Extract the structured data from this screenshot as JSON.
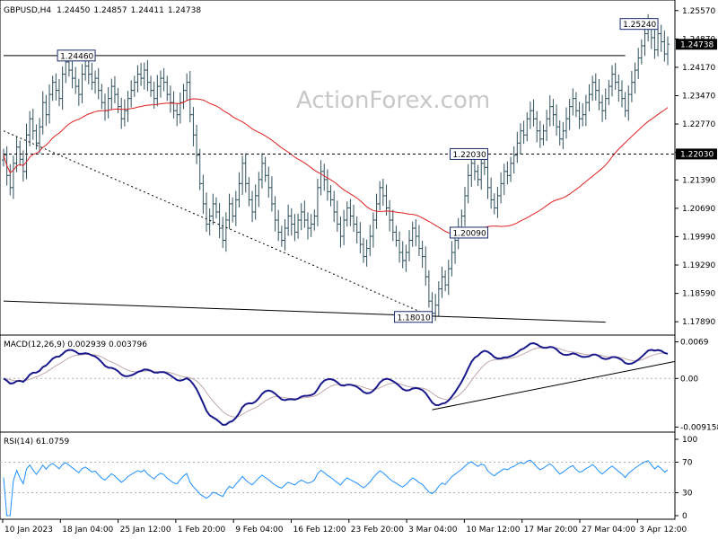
{
  "watermark": "ActionForex.com",
  "chart_data": [
    {
      "type": "candlestick",
      "title": "GBPUSD,H4",
      "ohlc_header": [
        "1.24450",
        "1.24857",
        "1.24411",
        "1.24738"
      ],
      "ylim": [
        1.1765,
        1.2572
      ],
      "y_ticks": [
        "1.25570",
        "1.24870",
        "1.24170",
        "1.23470",
        "1.22770",
        "1.22070",
        "1.21390",
        "1.20690",
        "1.19990",
        "1.19290",
        "1.18590",
        "1.17890"
      ],
      "last_price_label": "1.24738",
      "level_label": "1.22030",
      "x_tick_labels": [
        "10 Jan 2023",
        "18 Jan 04:00",
        "25 Jan 12:00",
        "1 Feb 20:00",
        "9 Feb 04:00",
        "16 Feb 12:00",
        "23 Feb 20:00",
        "3 Mar 04:00",
        "10 Mar 12:00",
        "17 Mar 20:00",
        "27 Mar 04:00",
        "3 Apr 12:00"
      ],
      "annotations": [
        {
          "text": "1.24460",
          "bar": 28,
          "value": 1.2446
        },
        {
          "text": "1.22030",
          "bar": 148,
          "value": 1.2203
        },
        {
          "text": "1.20090",
          "bar": 148,
          "value": 1.2009
        },
        {
          "text": "1.18010",
          "bar": 131,
          "value": 1.1801
        },
        {
          "text": "1.25240",
          "bar": 200,
          "value": 1.2524
        }
      ],
      "close": [
        1.22,
        1.215,
        1.212,
        1.218,
        1.222,
        1.219,
        1.216,
        1.225,
        1.229,
        1.226,
        1.223,
        1.227,
        1.233,
        1.23,
        1.235,
        1.238,
        1.236,
        1.234,
        1.24,
        1.243,
        1.241,
        1.239,
        1.237,
        1.235,
        1.24,
        1.242,
        1.24,
        1.238,
        1.239,
        1.236,
        1.233,
        1.231,
        1.234,
        1.237,
        1.235,
        1.232,
        1.229,
        1.231,
        1.234,
        1.236,
        1.238,
        1.24,
        1.239,
        1.241,
        1.238,
        1.236,
        1.234,
        1.237,
        1.239,
        1.238,
        1.235,
        1.233,
        1.231,
        1.23,
        1.233,
        1.236,
        1.238,
        1.23,
        1.225,
        1.22,
        1.213,
        1.208,
        1.203,
        1.205,
        1.208,
        1.206,
        1.202,
        1.199,
        1.204,
        1.208,
        1.205,
        1.209,
        1.213,
        1.218,
        1.213,
        1.209,
        1.206,
        1.21,
        1.214,
        1.218,
        1.215,
        1.212,
        1.208,
        1.204,
        1.201,
        1.199,
        1.202,
        1.205,
        1.203,
        1.201,
        1.204,
        1.206,
        1.204,
        1.202,
        1.203,
        1.205,
        1.212,
        1.216,
        1.214,
        1.211,
        1.209,
        1.206,
        1.203,
        1.2,
        1.204,
        1.207,
        1.205,
        1.203,
        1.201,
        1.198,
        1.195,
        1.197,
        1.2,
        1.204,
        1.208,
        1.212,
        1.21,
        1.207,
        1.204,
        1.201,
        1.199,
        1.196,
        1.194,
        1.196,
        1.199,
        1.202,
        1.2,
        1.197,
        1.195,
        1.19,
        1.184,
        1.181,
        1.183,
        1.187,
        1.19,
        1.188,
        1.192,
        1.196,
        1.199,
        1.202,
        1.205,
        1.21,
        1.215,
        1.218,
        1.216,
        1.214,
        1.218,
        1.217,
        1.212,
        1.209,
        1.207,
        1.21,
        1.213,
        1.216,
        1.215,
        1.218,
        1.22,
        1.223,
        1.226,
        1.225,
        1.229,
        1.231,
        1.229,
        1.226,
        1.224,
        1.226,
        1.229,
        1.232,
        1.23,
        1.227,
        1.224,
        1.226,
        1.229,
        1.232,
        1.234,
        1.231,
        1.229,
        1.23,
        1.233,
        1.235,
        1.238,
        1.236,
        1.233,
        1.231,
        1.234,
        1.237,
        1.24,
        1.238,
        1.236,
        1.234,
        1.231,
        1.235,
        1.238,
        1.241,
        1.244,
        1.247,
        1.25,
        1.252,
        1.249,
        1.246,
        1.25,
        1.248,
        1.245,
        1.2474
      ],
      "ma_series_name": "",
      "overlay_lines": [
        {
          "kind": "horizontal-resistance",
          "from_bar": 0,
          "to_bar": 190,
          "value": 1.2446
        },
        {
          "kind": "horizontal-dashed",
          "from_bar": 0,
          "to_bar": 215,
          "value": 1.2203
        },
        {
          "kind": "dotted-trendline",
          "from_bar": 0,
          "from_value": 1.226,
          "to_bar": 131,
          "to_value": 1.1801
        },
        {
          "kind": "long-trendline",
          "from_bar": 0,
          "from_value": 1.184,
          "to_bar": 184,
          "to_value": 1.1788
        }
      ]
    },
    {
      "type": "line",
      "title": "MACD(12,26,9) 0.002939 0.003796",
      "y_ticks": [
        "0.0069",
        "0.00",
        "-0.009158"
      ],
      "ylim": [
        -0.0096,
        0.0075
      ],
      "trendline": {
        "from_bar": 131,
        "from_value": -0.0059,
        "to_bar": 215,
        "to_value": 0.0032
      }
    },
    {
      "type": "line",
      "title": "RSI(14) 61.0759",
      "y_ticks": [
        "100",
        "70",
        "30",
        "0"
      ],
      "ylim": [
        0,
        100
      ],
      "levels": [
        70,
        30
      ]
    }
  ]
}
